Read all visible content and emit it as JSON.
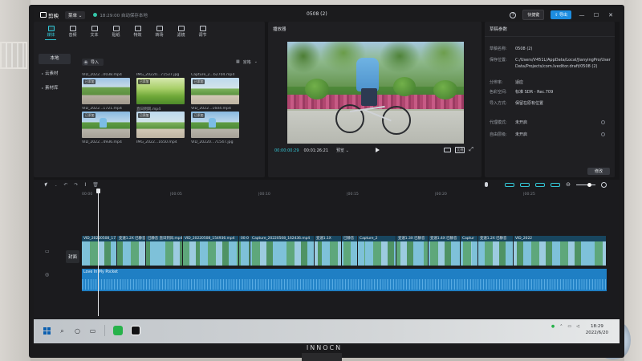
{
  "app": {
    "name": "剪映",
    "menu_label": "菜单",
    "autosave_text": "18:29:00 自动保存本地",
    "window_title": "0508 (2)",
    "shortcut_label": "快捷键",
    "export_label": "导出",
    "help_icon": "?"
  },
  "toolbar": [
    {
      "label": "媒体",
      "icon": "media-icon",
      "active": true
    },
    {
      "label": "音频",
      "icon": "audio-icon",
      "active": false
    },
    {
      "label": "文本",
      "icon": "text-icon",
      "active": false
    },
    {
      "label": "贴纸",
      "icon": "sticker-icon",
      "active": false
    },
    {
      "label": "特效",
      "icon": "effects-icon",
      "active": false
    },
    {
      "label": "转场",
      "icon": "transition-icon",
      "active": false
    },
    {
      "label": "滤镜",
      "icon": "filter-icon",
      "active": false
    },
    {
      "label": "调节",
      "icon": "adjust-icon",
      "active": false
    }
  ],
  "sidenav": [
    {
      "label": "本地",
      "active": true
    },
    {
      "label": "云素材",
      "active": false
    },
    {
      "label": "素材库",
      "active": false
    }
  ],
  "media": {
    "import_label": "导入",
    "sort_label": "宫格",
    "added_badge": "已添加",
    "items": [
      {
        "name": "VID_2022...0038.mp4"
      },
      {
        "name": "IMG_20220...71537.jpg"
      },
      {
        "name": "Capture_2...62704.mp4"
      },
      {
        "name": "VID_2022...1721.mp4"
      },
      {
        "name": "直日到风.mp4"
      },
      {
        "name": "VID_2022...1604.mp4"
      },
      {
        "name": "VID_2022...4936.mp4"
      },
      {
        "name": "IMG_2022...1650.mp4"
      },
      {
        "name": "VID_20220...71547.jpg"
      }
    ]
  },
  "player": {
    "title": "播放器",
    "current_time": "00:00:00:29",
    "total_time": "00:01:26:21",
    "mode_label": "预览",
    "ratio_label": "比例"
  },
  "draft": {
    "title": "草稿参数",
    "rows": [
      {
        "key": "草稿名称:",
        "value": "0508 (2)"
      },
      {
        "key": "保存位置:",
        "value": "C:/Users/V451L/AppData/Local/JianyingPro/User Data/Projects/com.lveditor.draft/0508 (2)"
      },
      {
        "key": "分辨率:",
        "value": "适应"
      },
      {
        "key": "色彩空间:",
        "value": "标准 SDR - Rec.709"
      },
      {
        "key": "导入方式:",
        "value": "保留在原有位置"
      },
      {
        "key": "代理模式:",
        "value": "未开启"
      },
      {
        "key": "自由层级:",
        "value": "未开启"
      }
    ],
    "edit_label": "修改"
  },
  "timeline": {
    "ruler": [
      "00:00",
      "|00:05",
      "|00:10",
      "|00:15",
      "|00:20",
      "|00:25"
    ],
    "cover_label": "封面",
    "clips": [
      {
        "label": "VID_20220508_171",
        "width": 44
      },
      {
        "label": "变速1.2X  已静音",
        "width": 36
      },
      {
        "label": "已静音  直日到风.mp4",
        "width": 46
      },
      {
        "label": "VID_20220508_154936.mp4",
        "width": 70
      },
      {
        "label": "00:0",
        "width": 14
      },
      {
        "label": "Capture_20220508_162436.mp4",
        "width": 80
      },
      {
        "label": "变速1.1X",
        "width": 34
      },
      {
        "label": "已静音",
        "width": 20
      },
      {
        "label": "Capture_2",
        "width": 48
      },
      {
        "label": "变速1.3X  已静音",
        "width": 40
      },
      {
        "label": "变速1.4X  已静音",
        "width": 40
      },
      {
        "label": "Captur",
        "width": 22
      },
      {
        "label": "变速1.2X  已静音",
        "width": 44
      },
      {
        "label": "VID_2022",
        "width": 116
      }
    ],
    "audio_name": "Love In My Pocket"
  },
  "taskbar": {
    "clock_time": "18:29",
    "clock_date": "2022/6/20"
  },
  "monitor_brand": "INNOCN"
}
